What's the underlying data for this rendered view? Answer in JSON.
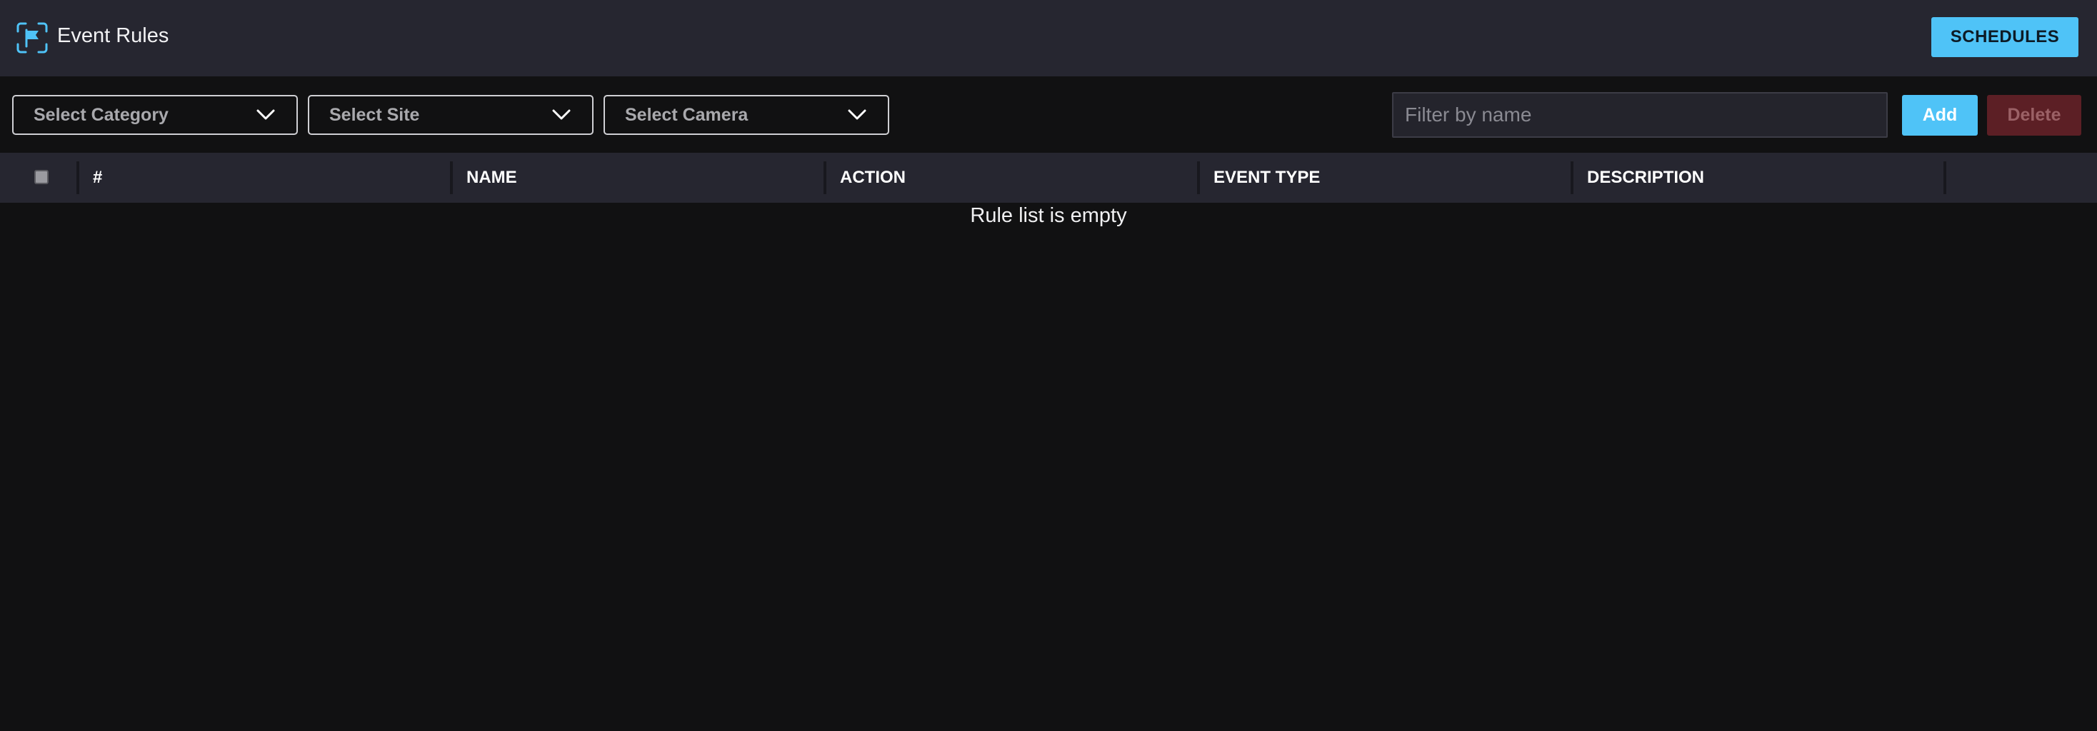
{
  "header": {
    "title": "Event Rules",
    "logo_icon": "flag-scan-icon",
    "schedules_label": "SCHEDULES"
  },
  "toolbar": {
    "category_select": "Select Category",
    "site_select": "Select Site",
    "camera_select": "Select Camera",
    "filter_placeholder": "Filter by name",
    "filter_value": "",
    "add_label": "Add",
    "delete_label": "Delete"
  },
  "table": {
    "columns": [
      "#",
      "NAME",
      "ACTION",
      "EVENT TYPE",
      "DESCRIPTION"
    ],
    "rows": [],
    "empty_message": "Rule list is empty"
  },
  "colors": {
    "accent": "#4fc3f7",
    "header_bg": "#262630",
    "page_bg": "#111112",
    "delete_disabled": "#5c1f25"
  }
}
